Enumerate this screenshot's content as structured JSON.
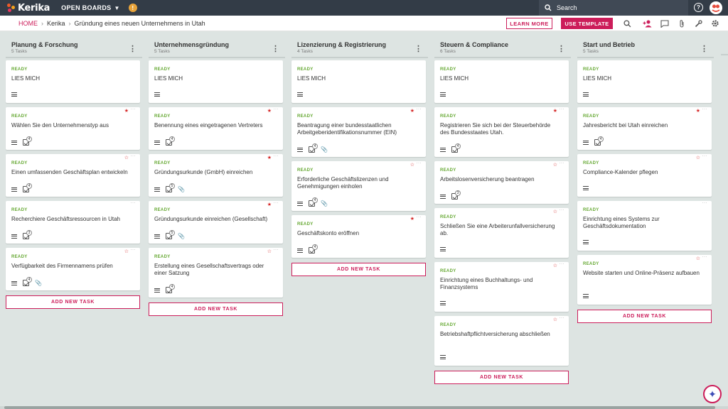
{
  "app": {
    "logo_text": "Kerika",
    "open_boards_label": "OPEN BOARDS",
    "org_badge": "!"
  },
  "search": {
    "placeholder": "Search"
  },
  "breadcrumb": {
    "home": "HOME",
    "account": "Kerika",
    "board": "Gründung eines neuen Unternehmens in Utah"
  },
  "actions": {
    "learn_more": "LEARN MORE",
    "use_template": "USE TEMPLATE"
  },
  "columns": [
    {
      "title": "Planung & Forschung",
      "count": "5 Tasks",
      "add_label": "ADD NEW TASK",
      "cards": [
        {
          "status": "READY",
          "title": "LIES MICH",
          "star": "none",
          "checklist": "",
          "attach": false
        },
        {
          "status": "READY",
          "title": "Wählen Sie den Unternehmenstyp aus",
          "star": "on",
          "checklist": "4",
          "attach": false
        },
        {
          "status": "READY",
          "title": "Einen umfassenden Geschäftsplan entwickeln",
          "star": "off",
          "checklist": "4",
          "attach": false
        },
        {
          "status": "READY",
          "title": "Recherchiere Geschäftsressourcen in Utah",
          "star": "none",
          "checklist": "3",
          "attach": false
        },
        {
          "status": "READY",
          "title": "Verfügbarkeit des Firmennamens prüfen",
          "star": "off",
          "checklist": "4",
          "attach": true
        }
      ]
    },
    {
      "title": "Unternehmensgründung",
      "count": "5 Tasks",
      "add_label": "ADD NEW TASK",
      "cards": [
        {
          "status": "READY",
          "title": "LIES MICH",
          "star": "none",
          "checklist": "",
          "attach": false
        },
        {
          "status": "READY",
          "title": "Benennung eines eingetragenen Vertreters",
          "star": "on",
          "checklist": "4",
          "attach": false
        },
        {
          "status": "READY",
          "title": "Gründungsurkunde (GmbH) einreichen",
          "star": "on",
          "checklist": "5",
          "attach": true
        },
        {
          "status": "READY",
          "title": "Gründungsurkunde einreichen (Gesellschaft)",
          "star": "on",
          "checklist": "5",
          "attach": true
        },
        {
          "status": "READY",
          "title": "Erstellung eines Gesellschaftsvertrags oder einer Satzung",
          "star": "off",
          "checklist": "4",
          "attach": false
        }
      ]
    },
    {
      "title": "Lizenzierung & Registrierung",
      "count": "4 Tasks",
      "add_label": "ADD NEW TASK",
      "cards": [
        {
          "status": "READY",
          "title": "LIES MICH",
          "star": "none",
          "checklist": "",
          "attach": false
        },
        {
          "status": "READY",
          "title": "Beantragung einer bundesstaatlichen Arbeitgeberidentifikationsnummer (EIN)",
          "star": "on",
          "checklist": "4",
          "attach": true
        },
        {
          "status": "READY",
          "title": "Erforderliche Geschäftslizenzen und Genehmigungen einholen",
          "star": "off",
          "checklist": "4",
          "attach": true
        },
        {
          "status": "READY",
          "title": "Geschäftskonto eröffnen",
          "star": "on",
          "checklist": "4",
          "attach": false
        }
      ]
    },
    {
      "title": "Steuern & Compliance",
      "count": "6 Tasks",
      "add_label": "ADD NEW TASK",
      "cards": [
        {
          "status": "READY",
          "title": "LIES MICH",
          "star": "none",
          "checklist": "",
          "attach": false
        },
        {
          "status": "READY",
          "title": "Registrieren Sie sich bei der Steuerbehörde des Bundesstaates Utah.",
          "star": "on",
          "checklist": "4",
          "attach": false
        },
        {
          "status": "READY",
          "title": "Arbeitslosenversicherung beantragen",
          "star": "off",
          "checklist": "3",
          "attach": false
        },
        {
          "status": "READY",
          "title": "Schließen Sie eine Arbeiterunfallversicherung ab.",
          "star": "off",
          "checklist": "",
          "attach": false
        },
        {
          "status": "READY",
          "title": "Einrichtung eines Buchhaltungs- und Finanzsystems",
          "star": "off",
          "checklist": "",
          "attach": false
        },
        {
          "status": "READY",
          "title": "Betriebshaftpflichtversicherung abschließen",
          "star": "off",
          "checklist": "",
          "attach": false
        }
      ]
    },
    {
      "title": "Start und Betrieb",
      "count": "5 Tasks",
      "add_label": "ADD NEW TASK",
      "cards": [
        {
          "status": "READY",
          "title": "LIES MICH",
          "star": "none",
          "checklist": "",
          "attach": false
        },
        {
          "status": "READY",
          "title": "Jahresbericht bei Utah einreichen",
          "star": "on",
          "checklist": "4",
          "attach": false
        },
        {
          "status": "READY",
          "title": "Compliance-Kalender pflegen",
          "star": "off",
          "checklist": "",
          "attach": false
        },
        {
          "status": "READY",
          "title": "Einrichtung eines Systems zur Geschäftsdokumentation",
          "star": "none",
          "checklist": "",
          "attach": false
        },
        {
          "status": "READY",
          "title": "Website starten und Online-Präsenz aufbauen",
          "star": "off",
          "checklist": "",
          "attach": false
        }
      ]
    }
  ],
  "colors": {
    "accent": "#cc1d5a",
    "ready": "#65a832",
    "star": "#d62a2a",
    "topbar": "#333c47",
    "board_bg": "#dde4e2"
  }
}
